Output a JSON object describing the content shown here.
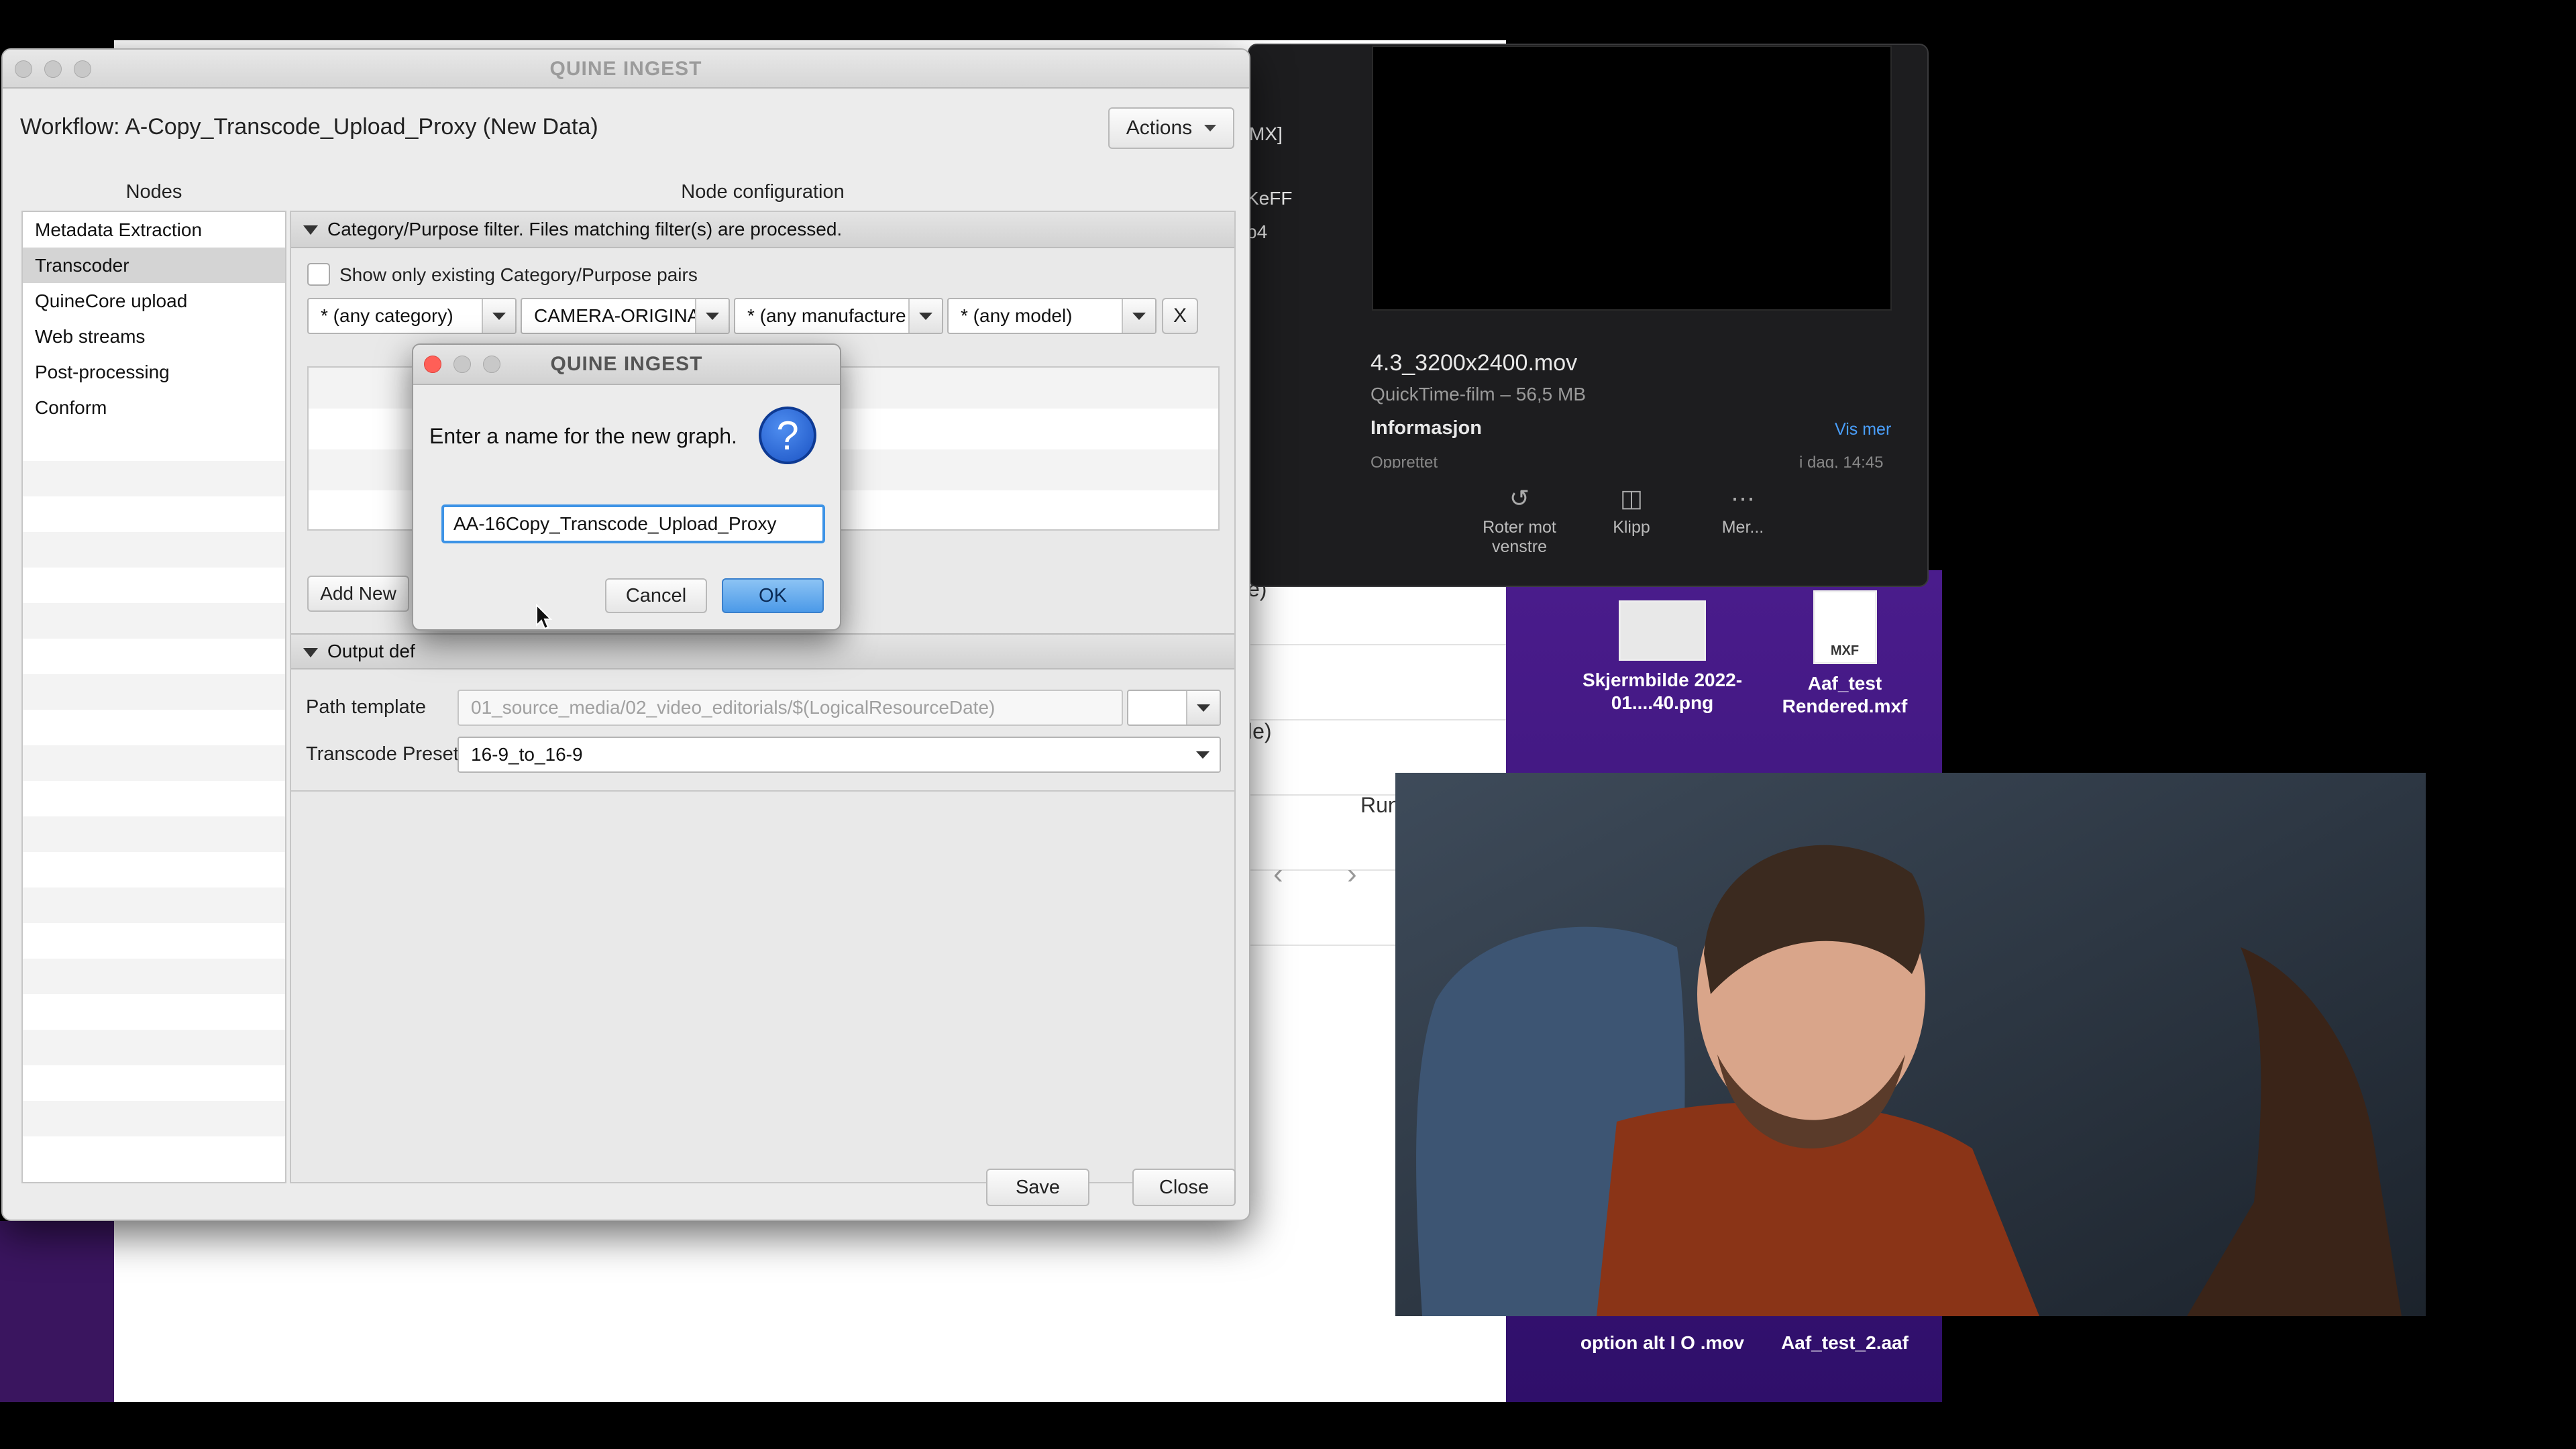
{
  "main_window": {
    "title": "QUINE INGEST",
    "workflow_label": "Workflow: A-Copy_Transcode_Upload_Proxy (New Data)",
    "actions_label": "Actions",
    "nodes_header": "Nodes",
    "config_header": "Node configuration",
    "nodes": [
      "Metadata Extraction",
      "Transcoder",
      "QuineCore upload",
      "Web streams",
      "Post-processing",
      "Conform"
    ],
    "selected_node": "Transcoder",
    "filter_section": {
      "header": "Category/Purpose filter. Files matching filter(s) are processed.",
      "checkbox_label": "Show only existing Category/Purpose pairs",
      "category": "* (any category)",
      "purpose": "CAMERA-ORIGINA",
      "manufacturer": "* (any manufacture",
      "model": "* (any model)",
      "remove_label": "X",
      "add_new_label": "Add New"
    },
    "output_section": {
      "header": "Output def",
      "path_template_label": "Path template",
      "path_template_value": "01_source_media/02_video_editorials/$(LogicalResourceDate)",
      "transcode_preset_label": "Transcode Preset",
      "transcode_preset_value": "16-9_to_16-9"
    },
    "save_label": "Save",
    "close_label": "Close"
  },
  "dialog": {
    "title": "QUINE INGEST",
    "prompt": "Enter a name for the new graph.",
    "question_glyph": "?",
    "input_value": "AA-16Copy_Transcode_Upload_Proxy",
    "cancel_label": "Cancel",
    "ok_label": "OK"
  },
  "preview_panel": {
    "file_name": "4.3_3200x2400.mov",
    "file_type": "QuickTime-film – 56,5 MB",
    "info_label": "Informasjon",
    "more_link": "Vis mer",
    "created_label": "Opprettet",
    "created_value": "i dag, 14:45",
    "actions": [
      {
        "label": "Roter mot venstre",
        "icon": "rotate-left-icon"
      },
      {
        "label": "Klipp",
        "icon": "trim-icon"
      },
      {
        "label": "Mer...",
        "icon": "more-icon"
      }
    ],
    "side_fragments": [
      "MX]",
      "KeFF",
      "p4"
    ]
  },
  "background_app": {
    "fragments": [
      "e)",
      "le)",
      "Run"
    ]
  },
  "desktop_files": [
    {
      "name": "Skjermbilde 2022-01....40.png",
      "icon": "screenshot-thumbnail"
    },
    {
      "name": "Aaf_test Rendered.mxf",
      "icon": "mxf-file-icon",
      "badge": "MXF"
    },
    {
      "name": "option alt I O .mov",
      "icon": "mov-file-icon"
    },
    {
      "name": "Aaf_test_2.aaf",
      "icon": "aaf-file-icon"
    }
  ]
}
